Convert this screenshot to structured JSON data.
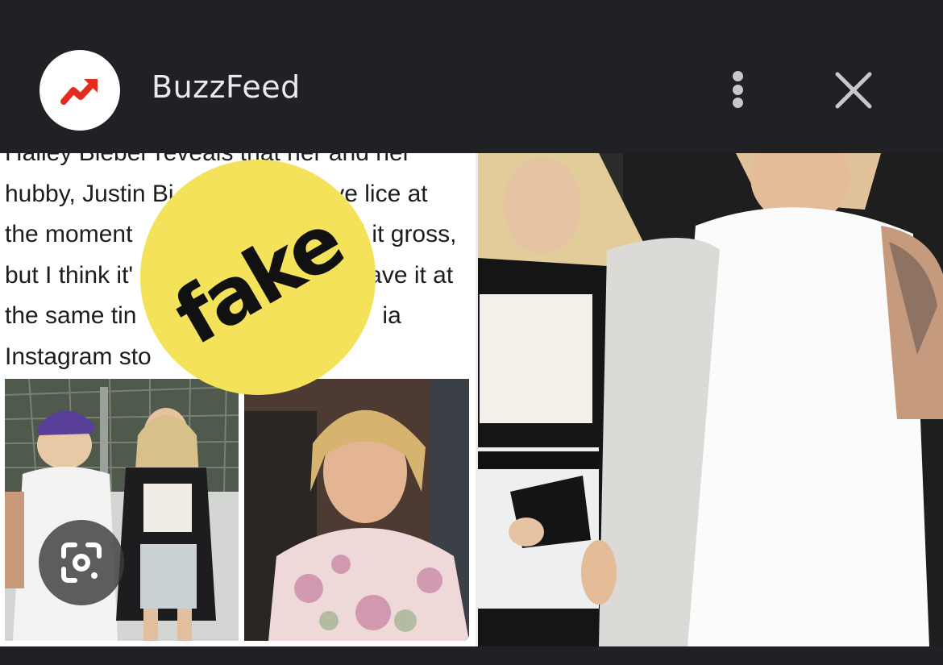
{
  "header": {
    "site_name": "BuzzFeed",
    "logo_icon": "trending-arrow-icon",
    "logo_color": "#e32c1e",
    "menu_icon": "more-vert-icon",
    "close_icon": "close-icon"
  },
  "tweet": {
    "lines": [
      "Hailey Bieber reveals that her and her",
      "hubby, Justin Bi",
      "ave lice at",
      "the moment",
      "l it gross,",
      "but I think it'",
      "ave it at",
      "the same tin",
      "ia",
      "Instagram sto"
    ]
  },
  "badge": {
    "label": "fake",
    "color": "#f4e35a"
  },
  "lens": {
    "icon": "google-lens-icon"
  }
}
